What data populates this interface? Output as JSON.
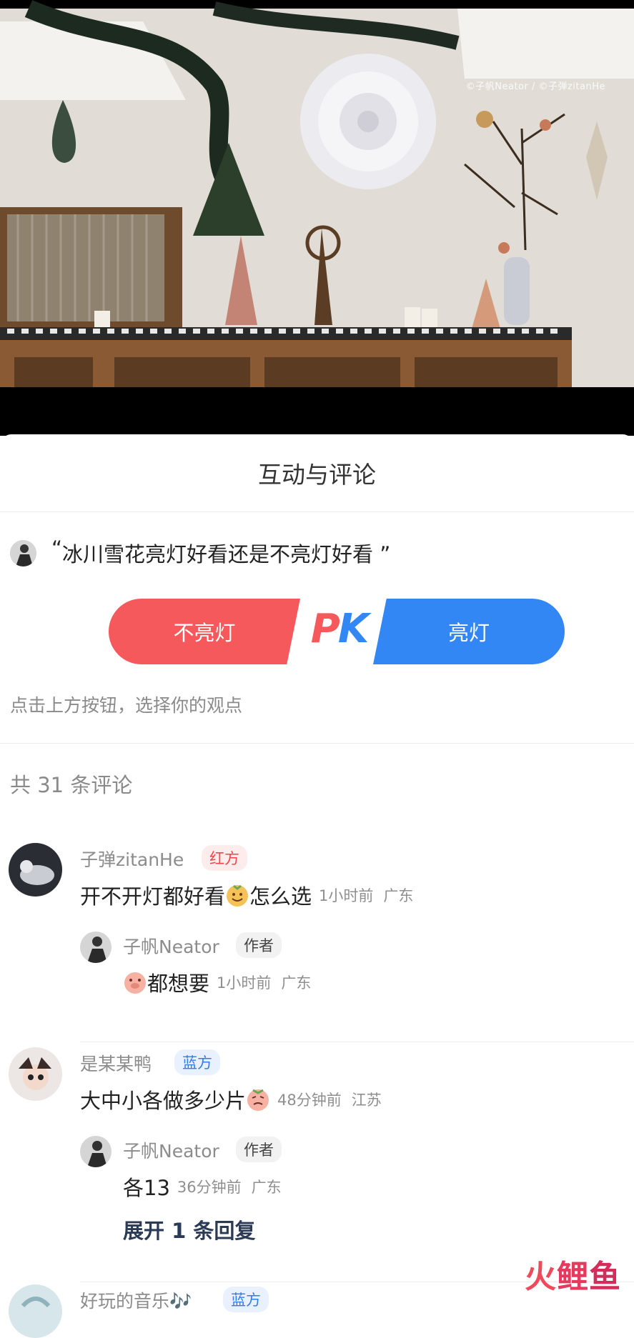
{
  "photo": {
    "watermark": "©子帆Neator / ©子弹zitanHe"
  },
  "sheet": {
    "title": "互动与评论",
    "question": "冰川雪花亮灯好看还是不亮灯好看",
    "quote_open": "“",
    "quote_close": "”",
    "pk": {
      "left_label": "不亮灯",
      "right_label": "亮灯",
      "logo_p": "P",
      "logo_k": "K",
      "left_color": "#f5595c",
      "right_color": "#3287f5"
    },
    "hint": "点击上方按钮，选择你的观点",
    "comment_count": "共 31 条评论"
  },
  "comments": [
    {
      "user": "子弹zitanHe",
      "badge": "红方",
      "text_a": "开不开灯都好看",
      "emoji_a": "smile-emoji-icon",
      "text_b": "怎么选",
      "time": "1小时前",
      "loc": "广东",
      "reply": {
        "user": "子帆Neator",
        "badge": "作者",
        "emoji": "pig-emoji-icon",
        "text": "都想要",
        "time": "1小时前",
        "loc": "广东"
      }
    },
    {
      "user": "是某某鸭",
      "badge": "蓝方",
      "text": "大中小各做多少片",
      "emoji": "cry-emoji-icon",
      "time": "48分钟前",
      "loc": "江苏",
      "reply": {
        "user": "子帆Neator",
        "badge": "作者",
        "text": "各13",
        "time": "36分钟前",
        "loc": "广东"
      },
      "expand": "展开 1 条回复"
    },
    {
      "user": "好玩的音乐🎶",
      "badge": "蓝方"
    }
  ],
  "brand": {
    "a": "火",
    "b": "鲤",
    "c": "鱼"
  }
}
